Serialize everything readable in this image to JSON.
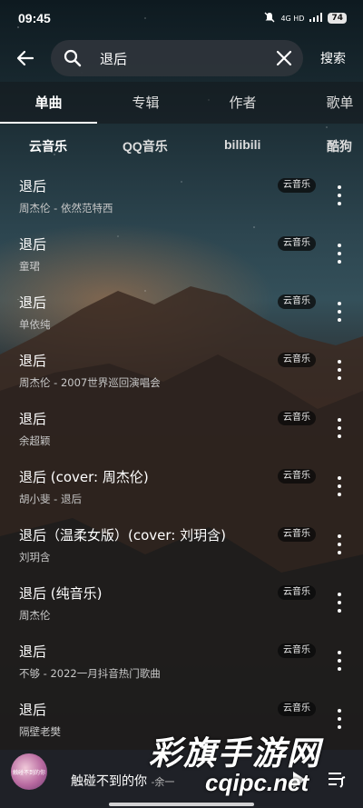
{
  "status_bar": {
    "time": "09:45",
    "network": "4G HD",
    "battery": "74"
  },
  "search": {
    "query": "退后",
    "submit_label": "搜索"
  },
  "tabs": [
    {
      "label": "单曲",
      "active": true
    },
    {
      "label": "专辑",
      "active": false
    },
    {
      "label": "作者",
      "active": false
    },
    {
      "label": "歌单",
      "active": false
    }
  ],
  "sources": [
    {
      "label": "云音乐",
      "active": true
    },
    {
      "label": "QQ音乐",
      "active": false
    },
    {
      "label": "bilibili",
      "active": false
    },
    {
      "label": "酷狗",
      "active": false
    }
  ],
  "songs": [
    {
      "title": "退后",
      "subtitle": "周杰伦 - 依然范特西",
      "source": "云音乐"
    },
    {
      "title": "退后",
      "subtitle": "童珺",
      "source": "云音乐"
    },
    {
      "title": "退后",
      "subtitle": "单依纯",
      "source": "云音乐"
    },
    {
      "title": "退后",
      "subtitle": "周杰伦 - 2007世界巡回演唱会",
      "source": "云音乐"
    },
    {
      "title": "退后",
      "subtitle": "余超颖",
      "source": "云音乐"
    },
    {
      "title": "退后 (cover: 周杰伦)",
      "subtitle": "胡小斐 - 退后",
      "source": "云音乐"
    },
    {
      "title": "退后（温柔女版）(cover: 刘玥含)",
      "subtitle": "刘玥含",
      "source": "云音乐"
    },
    {
      "title": "退后 (纯音乐)",
      "subtitle": "周杰伦",
      "source": "云音乐"
    },
    {
      "title": "退后",
      "subtitle": "不够 - 2022一月抖音热门歌曲",
      "source": "云音乐"
    },
    {
      "title": "退后",
      "subtitle": "隔壁老樊",
      "source": "云音乐"
    }
  ],
  "player": {
    "title": "触碰不到的你",
    "artist": "-余一",
    "cover_text": "触碰不到的你"
  },
  "watermark": {
    "line1": "彩旗手游网",
    "line2": "cqipc.net"
  }
}
